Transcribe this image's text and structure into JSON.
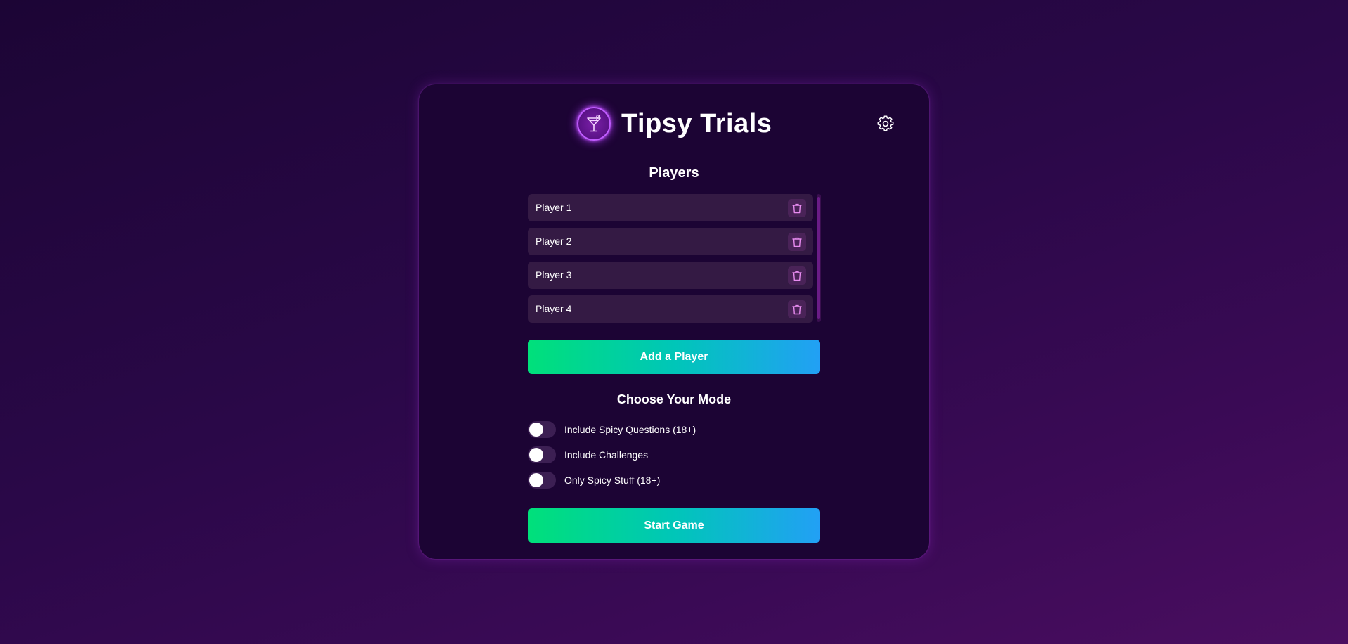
{
  "app": {
    "title": "Tipsy Trials",
    "logo_icon": "cocktail-glass-icon",
    "settings_icon": "gear-icon"
  },
  "players": {
    "heading": "Players",
    "items": [
      {
        "name": "Player 1"
      },
      {
        "name": "Player 2"
      },
      {
        "name": "Player 3"
      },
      {
        "name": "Player 4"
      }
    ],
    "delete_icon": "trash-icon",
    "add_button_label": "Add a Player"
  },
  "mode": {
    "heading": "Choose Your Mode",
    "options": [
      {
        "label": "Include Spicy Questions (18+)",
        "enabled": false
      },
      {
        "label": "Include Challenges",
        "enabled": false
      },
      {
        "label": "Only Spicy Stuff (18+)",
        "enabled": false
      }
    ]
  },
  "start_button_label": "Start Game",
  "colors": {
    "accent_gradient_start": "#00e07a",
    "accent_gradient_end": "#22a0f5",
    "card_background": "#1c0434",
    "neon_purple": "#b23cff",
    "delete_icon_color": "#e88cf0"
  }
}
